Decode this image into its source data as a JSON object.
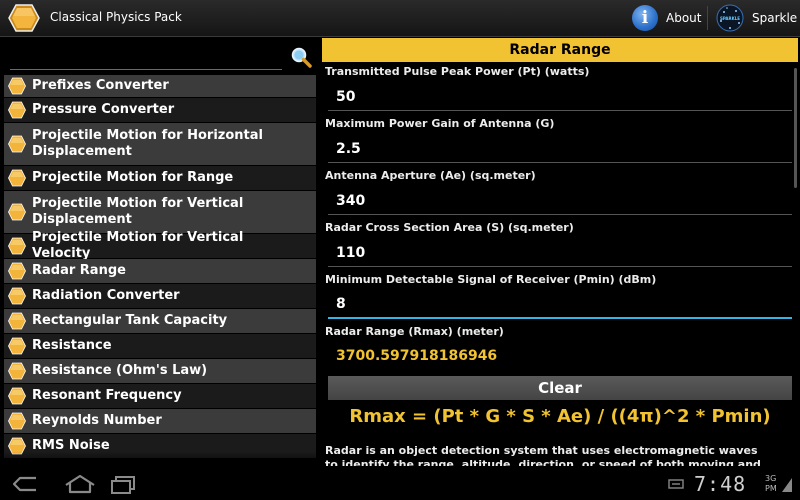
{
  "app": {
    "title": "Classical Physics Pack"
  },
  "actions": {
    "about_label": "About",
    "sparkle_label": "Sparkle",
    "sparkle_icon_text": "SPARKLE"
  },
  "search": {
    "value": "",
    "placeholder": ""
  },
  "list": {
    "items": [
      {
        "label": "Prefixes Converter"
      },
      {
        "label": "Pressure Converter"
      },
      {
        "label": "Projectile Motion for Horizontal Displacement"
      },
      {
        "label": "Projectile Motion for Range"
      },
      {
        "label": "Projectile Motion for Vertical Displacement"
      },
      {
        "label": "Projectile Motion for Vertical Velocity"
      },
      {
        "label": "Radar Range"
      },
      {
        "label": "Radiation Converter"
      },
      {
        "label": "Rectangular Tank Capacity"
      },
      {
        "label": "Resistance"
      },
      {
        "label": "Resistance (Ohm's Law)"
      },
      {
        "label": "Resonant Frequency"
      },
      {
        "label": "Reynolds Number"
      },
      {
        "label": "RMS Noise"
      }
    ]
  },
  "calculator": {
    "title": "Radar Range",
    "fields": [
      {
        "label": "Transmitted Pulse Peak Power (Pt) (watts)",
        "value": "50"
      },
      {
        "label": "Maximum Power Gain of Antenna (G)",
        "value": "2.5"
      },
      {
        "label": "Antenna Aperture (Ae) (sq.meter)",
        "value": "340"
      },
      {
        "label": "Radar Cross Section Area (S) (sq.meter)",
        "value": "110"
      },
      {
        "label": "Minimum Detectable Signal of Receiver (Pmin) (dBm)",
        "value": "8"
      }
    ],
    "result": {
      "label": "Radar Range (Rmax) (meter)",
      "value": "3700.597918186946"
    },
    "clear_label": "Clear",
    "formula": "Rmax = (Pt * G * S * Ae) / ((4π)^2 * Pmin)",
    "description": "Radar is an object detection system that uses electromagnetic waves to identify the range, altitude, direction, or speed of both moving and fixed"
  },
  "system": {
    "clock": "7:48",
    "indicator_1": "3G",
    "indicator_2": "PM"
  },
  "colors": {
    "accent": "#f1c232",
    "focus": "#33b5e5"
  }
}
